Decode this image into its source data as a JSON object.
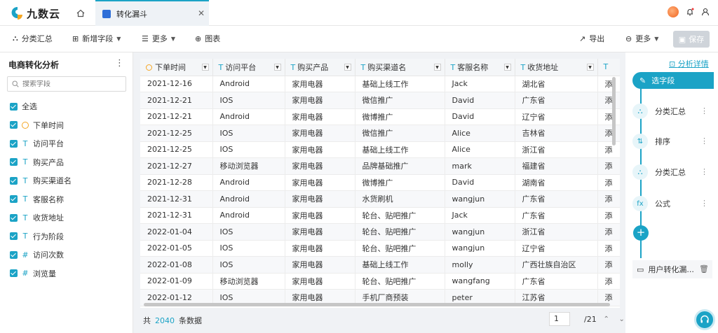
{
  "app": {
    "logo_text": "九数云",
    "tab_title": "转化漏斗"
  },
  "toolbar": {
    "group_summary": "分类汇总",
    "add_field": "新增字段",
    "more_left": "更多",
    "chart": "图表",
    "export": "导出",
    "more_right": "更多",
    "save": "保存"
  },
  "left_panel": {
    "title": "电商转化分析",
    "search_placeholder": "搜索字段",
    "select_all": "全选",
    "fields": [
      {
        "label": "下单时间",
        "type": "date"
      },
      {
        "label": "访问平台",
        "type": "text"
      },
      {
        "label": "购买产品",
        "type": "text"
      },
      {
        "label": "购买渠道名",
        "type": "text"
      },
      {
        "label": "客服名称",
        "type": "text"
      },
      {
        "label": "收货地址",
        "type": "text"
      },
      {
        "label": "行为阶段",
        "type": "text"
      },
      {
        "label": "访问次数",
        "type": "number"
      },
      {
        "label": "浏览量",
        "type": "number"
      }
    ]
  },
  "table": {
    "columns": [
      "下单时间",
      "访问平台",
      "购买产品",
      "购买渠道名",
      "客服名称",
      "收货地址",
      "T"
    ],
    "rows": [
      [
        "2021-12-16",
        "Android",
        "家用电器",
        "基础上线工作",
        "Jack",
        "湖北省",
        "添"
      ],
      [
        "2021-12-21",
        "IOS",
        "家用电器",
        "微信推广",
        "David",
        "广东省",
        "添"
      ],
      [
        "2021-12-21",
        "Android",
        "家用电器",
        "微博推广",
        "David",
        "辽宁省",
        "添"
      ],
      [
        "2021-12-25",
        "IOS",
        "家用电器",
        "微信推广",
        "Alice",
        "吉林省",
        "添"
      ],
      [
        "2021-12-25",
        "IOS",
        "家用电器",
        "基础上线工作",
        "Alice",
        "浙江省",
        "添"
      ],
      [
        "2021-12-27",
        "移动浏览器",
        "家用电器",
        "品牌基础推广",
        "mark",
        "福建省",
        "添"
      ],
      [
        "2021-12-28",
        "Android",
        "家用电器",
        "微博推广",
        "David",
        "湖南省",
        "添"
      ],
      [
        "2021-12-31",
        "Android",
        "家用电器",
        "水货刷机",
        "wangjun",
        "广东省",
        "添"
      ],
      [
        "2021-12-31",
        "Android",
        "家用电器",
        "轮台、贴吧推广",
        "Jack",
        "广东省",
        "添"
      ],
      [
        "2022-01-04",
        "IOS",
        "家用电器",
        "轮台、贴吧推广",
        "wangjun",
        "浙江省",
        "添"
      ],
      [
        "2022-01-05",
        "IOS",
        "家用电器",
        "轮台、贴吧推广",
        "wangjun",
        "辽宁省",
        "添"
      ],
      [
        "2022-01-08",
        "IOS",
        "家用电器",
        "基础上线工作",
        "molly",
        "广西壮族自治区",
        "添"
      ],
      [
        "2022-01-09",
        "移动浏览器",
        "家用电器",
        "轮台、贴吧推广",
        "wangfang",
        "广东省",
        "添"
      ],
      [
        "2022-01-12",
        "IOS",
        "家用电器",
        "手机厂商预装",
        "peter",
        "江苏省",
        "添"
      ]
    ]
  },
  "footer": {
    "prefix": "共",
    "total": "2040",
    "suffix": "条数据",
    "current_page": "1",
    "total_pages": "/21"
  },
  "right_panel": {
    "detail_link": "分析详情",
    "steps": [
      "选字段",
      "分类汇总",
      "排序",
      "分类汇总",
      "公式"
    ],
    "result_label": "用户转化漏..."
  },
  "colors": {
    "accent": "#1ba3c6",
    "date_icon": "#f5a623"
  }
}
